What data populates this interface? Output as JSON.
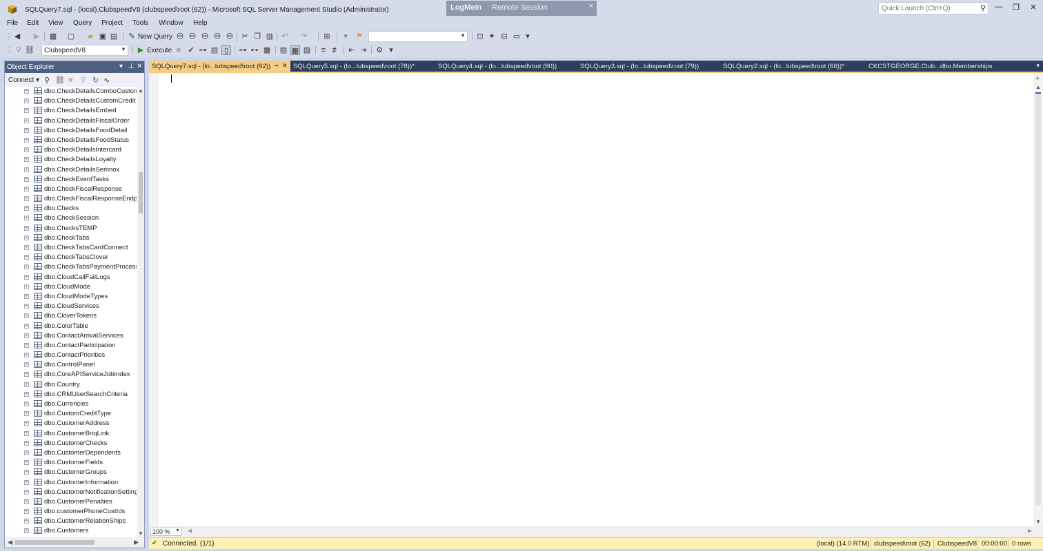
{
  "window": {
    "title": "SQLQuery7.sql - (local).ClubspeedV8 (clubspeed\\root (62)) - Microsoft SQL Server Management Studio (Administrator)",
    "overlay_brand": "LogMeIn",
    "overlay_text": "Remote Session",
    "overlay_close": "×",
    "quick_launch_placeholder": "Quick Launch (Ctrl+Q)",
    "controls": {
      "minimize": "—",
      "restore": "❐",
      "close": "✕"
    }
  },
  "menu": [
    "File",
    "Edit",
    "View",
    "Query",
    "Project",
    "Tools",
    "Window",
    "Help"
  ],
  "toolbar1": {
    "new_query_label": "New Query",
    "solution_config_value": ""
  },
  "toolbar2": {
    "database_value": "ClubspeedV8",
    "execute_label": "Execute"
  },
  "object_explorer": {
    "title": "Object Explorer",
    "connect_label": "Connect ▾",
    "header_controls": [
      "▾",
      "⊥",
      "✕"
    ],
    "items": [
      "dbo.CheckDetailsComboCustom",
      "dbo.CheckDetailsCustomCredit",
      "dbo.CheckDetailsEmbed",
      "dbo.CheckDetailsFiscalOrder",
      "dbo.CheckDetailsFoodDetail",
      "dbo.CheckDetailsFoodStatus",
      "dbo.CheckDetailsIntercard",
      "dbo.CheckDetailsLoyalty",
      "dbo.CheckDetailsSemnox",
      "dbo.CheckEventTasks",
      "dbo.CheckFiscalResponse",
      "dbo.CheckFiscalResponseEndpoint",
      "dbo.Checks",
      "dbo.CheckSession",
      "dbo.ChecksTEMP",
      "dbo.CheckTabs",
      "dbo.CheckTabsCardConnect",
      "dbo.CheckTabsClover",
      "dbo.CheckTabsPaymentProcess",
      "dbo.CloudCallFailLogs",
      "dbo.CloudMode",
      "dbo.CloudModeTypes",
      "dbo.CloudServices",
      "dbo.CloverTokens",
      "dbo.ColorTable",
      "dbo.ContactArrivalServices",
      "dbo.ContactParticipation",
      "dbo.ContactPriorities",
      "dbo.ControlPanel",
      "dbo.CoreAPIServiceJobIndex",
      "dbo.Country",
      "dbo.CRMUserSearchCriteria",
      "dbo.Currencies",
      "dbo.CustomCreditType",
      "dbo.CustomerAddress",
      "dbo.CustomerBriqLink",
      "dbo.CustomerChecks",
      "dbo.CustomerDependents",
      "dbo.CustomerFields",
      "dbo.CustomerGroups",
      "dbo.CustomerInformation",
      "dbo.CustomerNotificationSettings",
      "dbo.CustomerPenalties",
      "dbo.customerPhoneCustIds",
      "dbo.CustomerRelationShips",
      "dbo.Customers"
    ]
  },
  "tabs": [
    {
      "label": "SQLQuery7.sql - (lo...lubspeed\\root (62))",
      "active": true
    },
    {
      "label": "SQLQuery5.sql - (lo...lubspeed\\root (78))*",
      "active": false
    },
    {
      "label": "SQLQuery4.sql - (lo...lubspeed\\root (80))",
      "active": false
    },
    {
      "label": "SQLQuery3.sql - (lo...lubspeed\\root (79))",
      "active": false
    },
    {
      "label": "SQLQuery2.sql - (lo...lubspeed\\root (66))*",
      "active": false
    },
    {
      "label": "CKCSTGEORGE.Club...dbo.Memberships",
      "active": false
    }
  ],
  "editor": {
    "zoom": "100 %"
  },
  "status": {
    "connection": "Connected. (1/1)",
    "server": "(local) (14.0 RTM)",
    "user": "clubspeed\\root (62)",
    "database": "ClubspeedV8",
    "elapsed": "00:00:00",
    "rows": "0 rows"
  },
  "colors": {
    "title_bg": "#d6dbe9",
    "tab_strip_bg": "#2e3e5e",
    "active_tab": "#f5cc84",
    "oe_header": "#4d6082",
    "status_bg": "#fcf0b5"
  }
}
